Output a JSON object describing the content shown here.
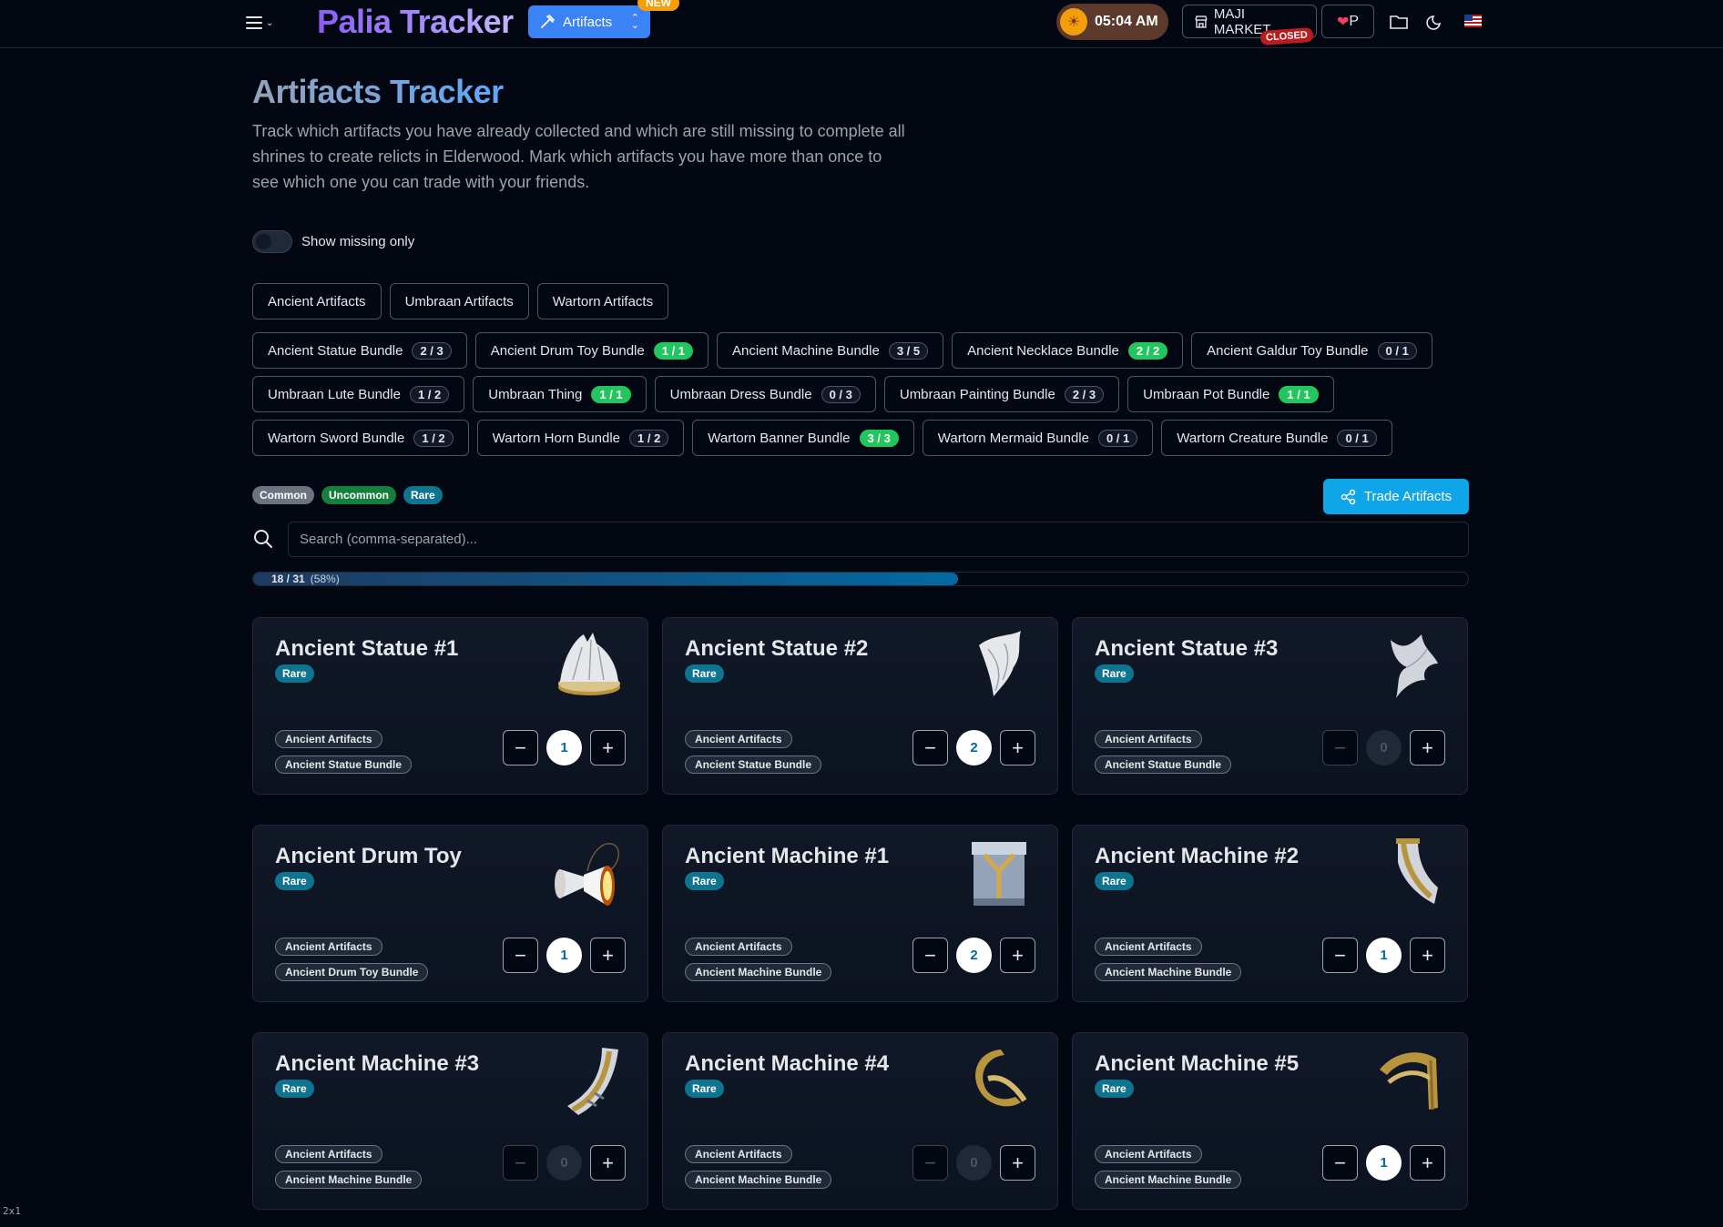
{
  "header": {
    "brand": "Palia Tracker",
    "nav_label": "Artifacts",
    "new_badge": "NEW",
    "time": "05:04 AM",
    "market_label": "MAJI MARKET",
    "market_status": "CLOSED"
  },
  "page": {
    "title": "Artifacts Tracker",
    "intro": "Track which artifacts you have already collected and which are still missing to complete all shrines to create relicts in Elderwood. Mark which artifacts you have more than once to see which one you can trade with your friends.",
    "toggle_label": "Show missing only",
    "categories": [
      "Ancient Artifacts",
      "Umbraan Artifacts",
      "Wartorn Artifacts"
    ],
    "bundle_rows": [
      [
        {
          "label": "Ancient Statue Bundle",
          "count": "2 / 3",
          "complete": false
        },
        {
          "label": "Ancient Drum Toy Bundle",
          "count": "1 / 1",
          "complete": true
        },
        {
          "label": "Ancient Machine Bundle",
          "count": "3 / 5",
          "complete": false
        },
        {
          "label": "Ancient Necklace Bundle",
          "count": "2 / 2",
          "complete": true
        },
        {
          "label": "Ancient Galdur Toy Bundle",
          "count": "0 / 1",
          "complete": false
        }
      ],
      [
        {
          "label": "Umbraan Lute Bundle",
          "count": "1 / 2",
          "complete": false
        },
        {
          "label": "Umbraan Thing",
          "count": "1 / 1",
          "complete": true
        },
        {
          "label": "Umbraan Dress Bundle",
          "count": "0 / 3",
          "complete": false
        },
        {
          "label": "Umbraan Painting Bundle",
          "count": "2 / 3",
          "complete": false
        },
        {
          "label": "Umbraan Pot Bundle",
          "count": "1 / 1",
          "complete": true
        }
      ],
      [
        {
          "label": "Wartorn Sword Bundle",
          "count": "1 / 2",
          "complete": false
        },
        {
          "label": "Wartorn Horn Bundle",
          "count": "1 / 2",
          "complete": false
        },
        {
          "label": "Wartorn Banner Bundle",
          "count": "3 / 3",
          "complete": true
        },
        {
          "label": "Wartorn Mermaid Bundle",
          "count": "0 / 1",
          "complete": false
        },
        {
          "label": "Wartorn Creature Bundle",
          "count": "0 / 1",
          "complete": false
        }
      ]
    ],
    "rarity_filters": [
      "Common",
      "Uncommon",
      "Rare"
    ],
    "trade_label": "Trade Artifacts",
    "search_placeholder": "Search (comma-separated)...",
    "progress": {
      "text": "18 / 31",
      "percent_text": "(58%)",
      "fraction": 0.58
    }
  },
  "cards": [
    {
      "name": "Ancient Statue #1",
      "rarity": "Rare",
      "category": "Ancient Artifacts",
      "bundle": "Ancient Statue Bundle",
      "qty": "1",
      "icon": "statue-dome-icon"
    },
    {
      "name": "Ancient Statue #2",
      "rarity": "Rare",
      "category": "Ancient Artifacts",
      "bundle": "Ancient Statue Bundle",
      "qty": "2",
      "icon": "statue-cloth-icon"
    },
    {
      "name": "Ancient Statue #3",
      "rarity": "Rare",
      "category": "Ancient Artifacts",
      "bundle": "Ancient Statue Bundle",
      "qty": "0",
      "icon": "statue-wing-icon"
    },
    {
      "name": "Ancient Drum Toy",
      "rarity": "Rare",
      "category": "Ancient Artifacts",
      "bundle": "Ancient Drum Toy Bundle",
      "qty": "1",
      "icon": "drum-toy-icon"
    },
    {
      "name": "Ancient Machine #1",
      "rarity": "Rare",
      "category": "Ancient Artifacts",
      "bundle": "Ancient Machine Bundle",
      "qty": "2",
      "icon": "machine-block-icon"
    },
    {
      "name": "Ancient Machine #2",
      "rarity": "Rare",
      "category": "Ancient Artifacts",
      "bundle": "Ancient Machine Bundle",
      "qty": "1",
      "icon": "machine-curve-icon"
    },
    {
      "name": "Ancient Machine #3",
      "rarity": "Rare",
      "category": "Ancient Artifacts",
      "bundle": "Ancient Machine Bundle",
      "qty": "0",
      "icon": "machine-arc-icon"
    },
    {
      "name": "Ancient Machine #4",
      "rarity": "Rare",
      "category": "Ancient Artifacts",
      "bundle": "Ancient Machine Bundle",
      "qty": "0",
      "icon": "machine-ring-icon"
    },
    {
      "name": "Ancient Machine #5",
      "rarity": "Rare",
      "category": "Ancient Artifacts",
      "bundle": "Ancient Machine Bundle",
      "qty": "1",
      "icon": "machine-fan-icon"
    }
  ],
  "footer": {
    "zoom": "2x1"
  }
}
